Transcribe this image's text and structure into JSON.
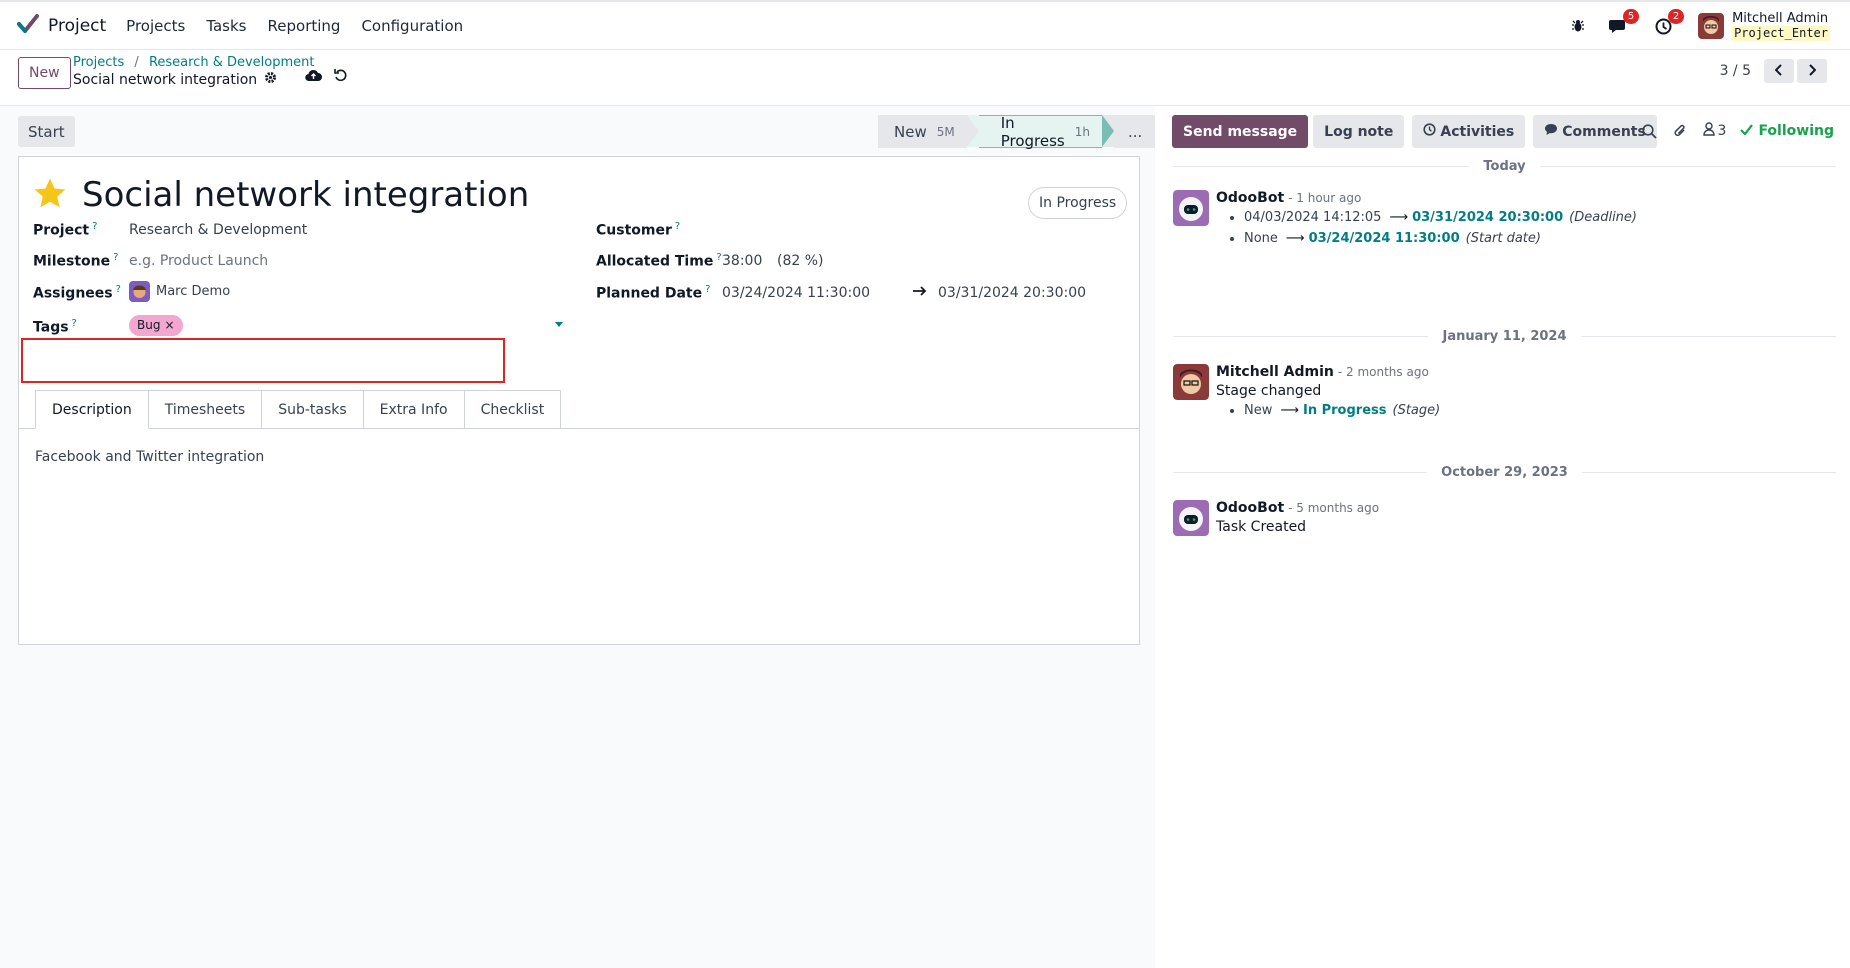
{
  "topbar": {
    "app_name": "Project",
    "menu": [
      "Projects",
      "Tasks",
      "Reporting",
      "Configuration"
    ],
    "messages_badge": "5",
    "activities_badge": "2",
    "user_name": "Mitchell Admin",
    "database": "Project_Enter"
  },
  "control": {
    "new_label": "New",
    "breadcrumb_projects": "Projects",
    "breadcrumb_separator": "/",
    "breadcrumb_project": "Research & Development",
    "current_record": "Social network integration",
    "pager": "3 / 5"
  },
  "statusbar": {
    "start_label": "Start",
    "stages": [
      {
        "label": "New",
        "duration": "5M"
      },
      {
        "label": "In Progress",
        "duration": "1h"
      }
    ],
    "more_label": "..."
  },
  "form": {
    "title": "Social network integration",
    "status": "In Progress",
    "project_label": "Project",
    "project_value": "Research & Development",
    "milestone_label": "Milestone",
    "milestone_placeholder": "e.g. Product Launch",
    "assignees_label": "Assignees",
    "assignee": "Marc Demo",
    "tags_label": "Tags",
    "tag": "Bug",
    "tag_remove": "×",
    "customer_label": "Customer",
    "allocated_label": "Allocated Time",
    "allocated_value": "38:00",
    "allocated_percent": "(82 %)",
    "planned_label": "Planned Date",
    "planned_start": "03/24/2024 11:30:00",
    "planned_end": "03/31/2024 20:30:00",
    "help_mark": "?",
    "tabs": [
      "Description",
      "Timesheets",
      "Sub-tasks",
      "Extra Info",
      "Checklist"
    ],
    "description": "Facebook and Twitter integration"
  },
  "chatter": {
    "send_message": "Send message",
    "log_note": "Log note",
    "activities": "Activities",
    "comments": "Comments",
    "followers_count": "3",
    "following": "Following",
    "groups": [
      {
        "date": "Today",
        "author": "OdooBot",
        "when": "- 1 hour ago",
        "changes": [
          {
            "old": "04/03/2024 14:12:05",
            "new": "03/31/2024 20:30:00",
            "field": "(Deadline)"
          },
          {
            "old": "None",
            "new": "03/24/2024 11:30:00",
            "field": "(Start date)"
          }
        ]
      },
      {
        "date": "January 11, 2024",
        "author": "Mitchell Admin",
        "when": "- 2 months ago",
        "text": "Stage changed",
        "changes": [
          {
            "old": "New",
            "new": "In Progress",
            "field": "(Stage)"
          }
        ]
      },
      {
        "date": "October 29, 2023",
        "author": "OdooBot",
        "when": "- 5 months ago",
        "text": "Task Created"
      }
    ]
  },
  "icons": {
    "brand": "checkmark-logo-icon",
    "bug": "bug-icon",
    "chat": "chat-bubble-icon",
    "clock": "clock-icon",
    "gear": "gear-icon",
    "save": "cloud-upload-icon",
    "discard": "undo-icon",
    "search": "search-icon",
    "attachment": "paperclip-icon",
    "followers": "person-icon",
    "check": "check-icon",
    "star": "star-icon"
  },
  "colors": {
    "brand": "#714b67",
    "link": "#017e84",
    "following": "#16a34a",
    "badge": "#dc2626",
    "tag_bug": "#f3a6cf",
    "star": "#f5c518"
  }
}
